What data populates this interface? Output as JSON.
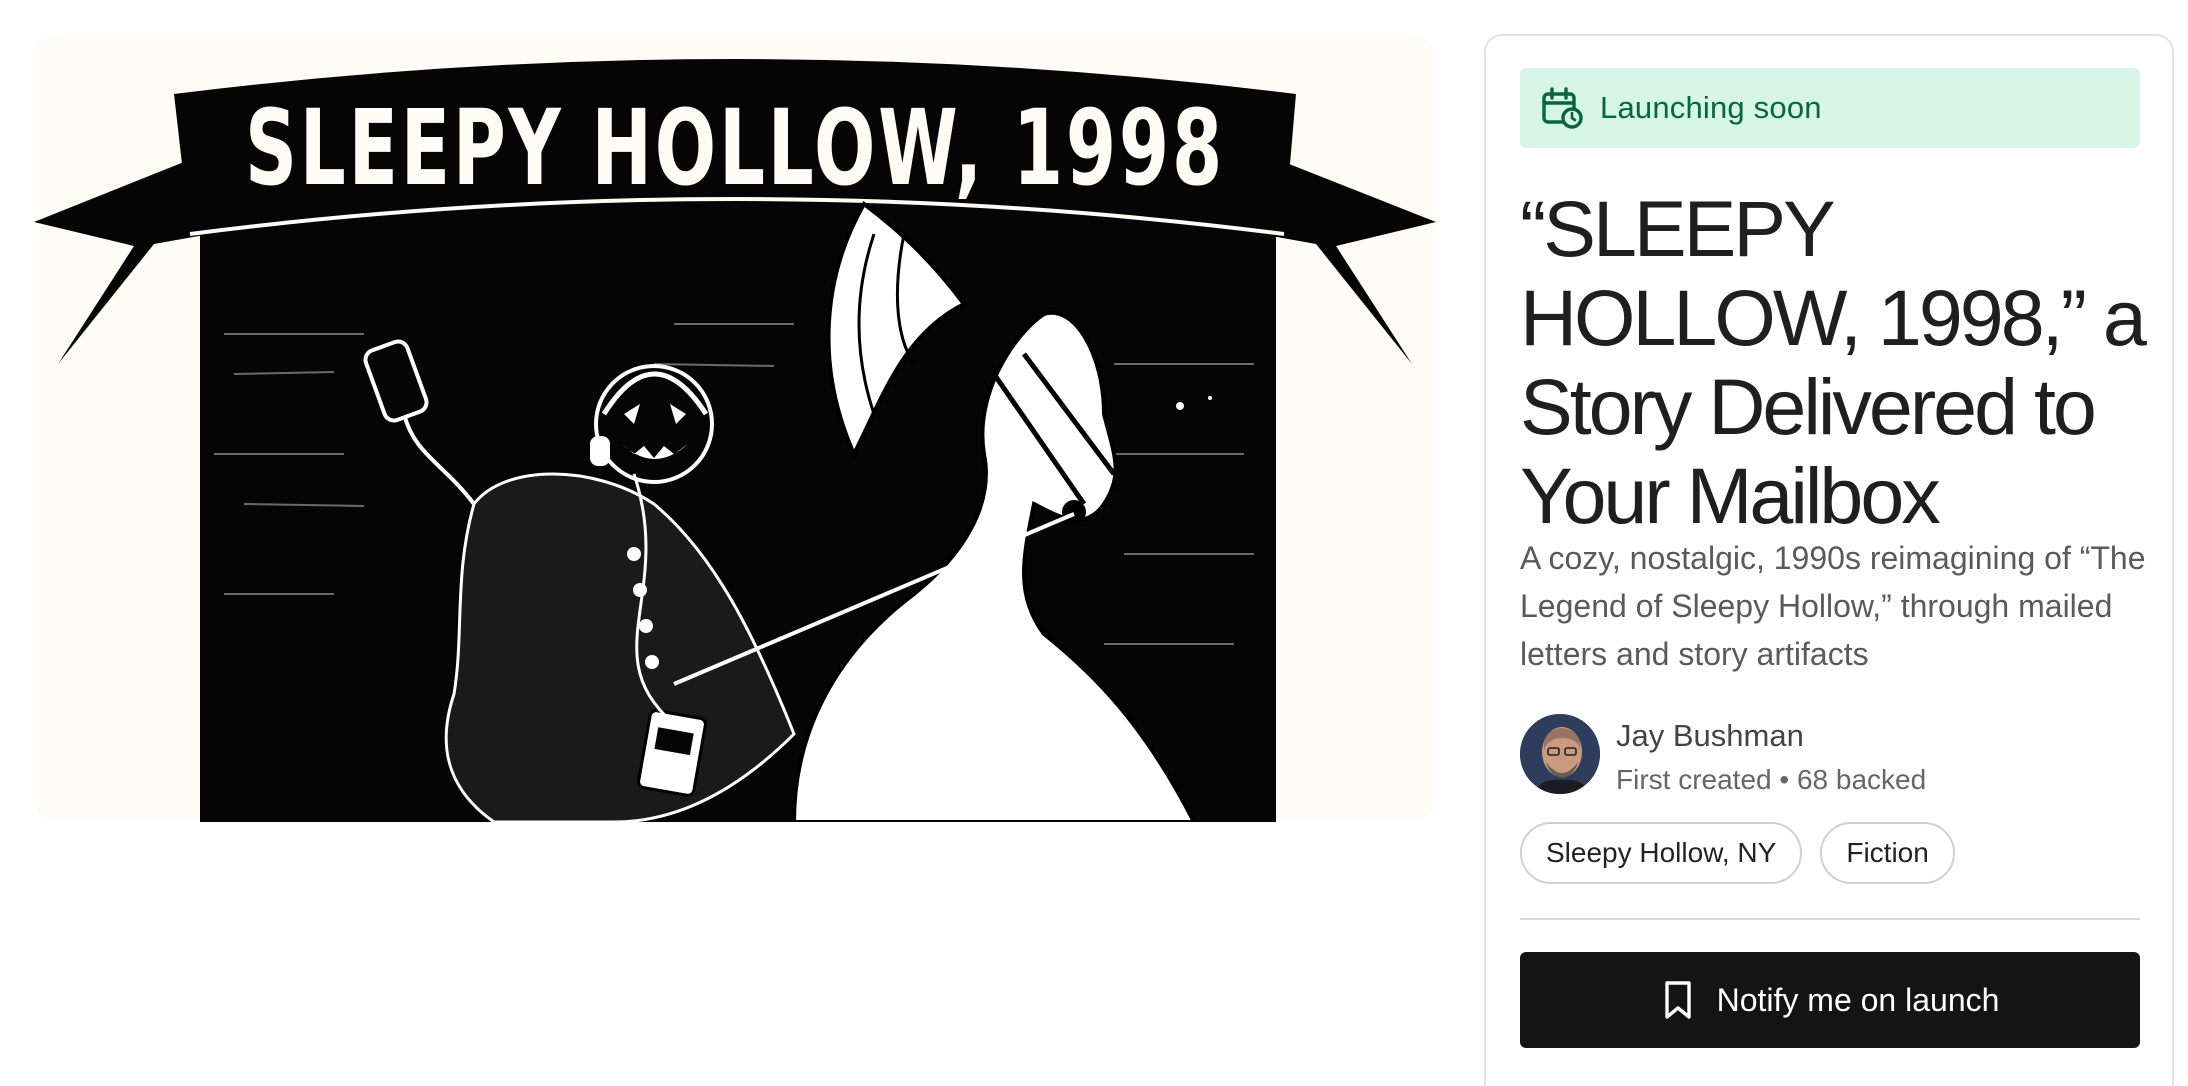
{
  "hero": {
    "banner_text": "SLEEPY HOLLOW, 1998",
    "colors": {
      "ink": "#000000",
      "paper": "#fdfcf5"
    }
  },
  "card": {
    "status": {
      "label": "Launching soon",
      "icon": "calendar-clock-icon",
      "color": "#05663f",
      "background": "#d6f5e6"
    },
    "title": "“SLEEPY HOLLOW, 1998,” a Story Delivered to Your Mailbox",
    "blurb": "A cozy, nostalgic, 1990s reimagining of “The Legend of Sleepy Hollow,” through mailed letters and story artifacts",
    "creator": {
      "name": "Jay Bushman",
      "meta": "First created • 68 backed"
    },
    "tags": [
      "Sleepy Hollow, NY",
      "Fiction"
    ],
    "notify_button": {
      "label": "Notify me on launch",
      "icon": "bookmark-icon"
    }
  }
}
